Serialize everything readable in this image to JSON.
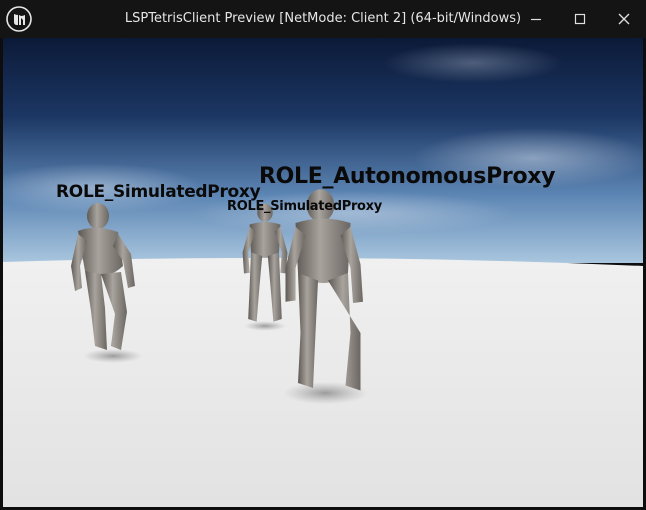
{
  "window": {
    "title": "LSPTetrisClient Preview [NetMode: Client 2]  (64-bit/Windows)",
    "logo_icon": "unreal-engine-logo",
    "controls": {
      "minimize_icon": "minimize-icon",
      "maximize_icon": "maximize-icon",
      "close_icon": "close-icon"
    }
  },
  "scene": {
    "sky_color_top": "#0f1e3e",
    "sky_color_horizon": "#8fb3d1",
    "floor_color": "#e9e9e9",
    "characters": [
      {
        "role_label": "ROLE_SimulatedProxy"
      },
      {
        "role_label": "ROLE_SimulatedProxy"
      },
      {
        "role_label": "ROLE_AutonomousProxy"
      }
    ]
  }
}
